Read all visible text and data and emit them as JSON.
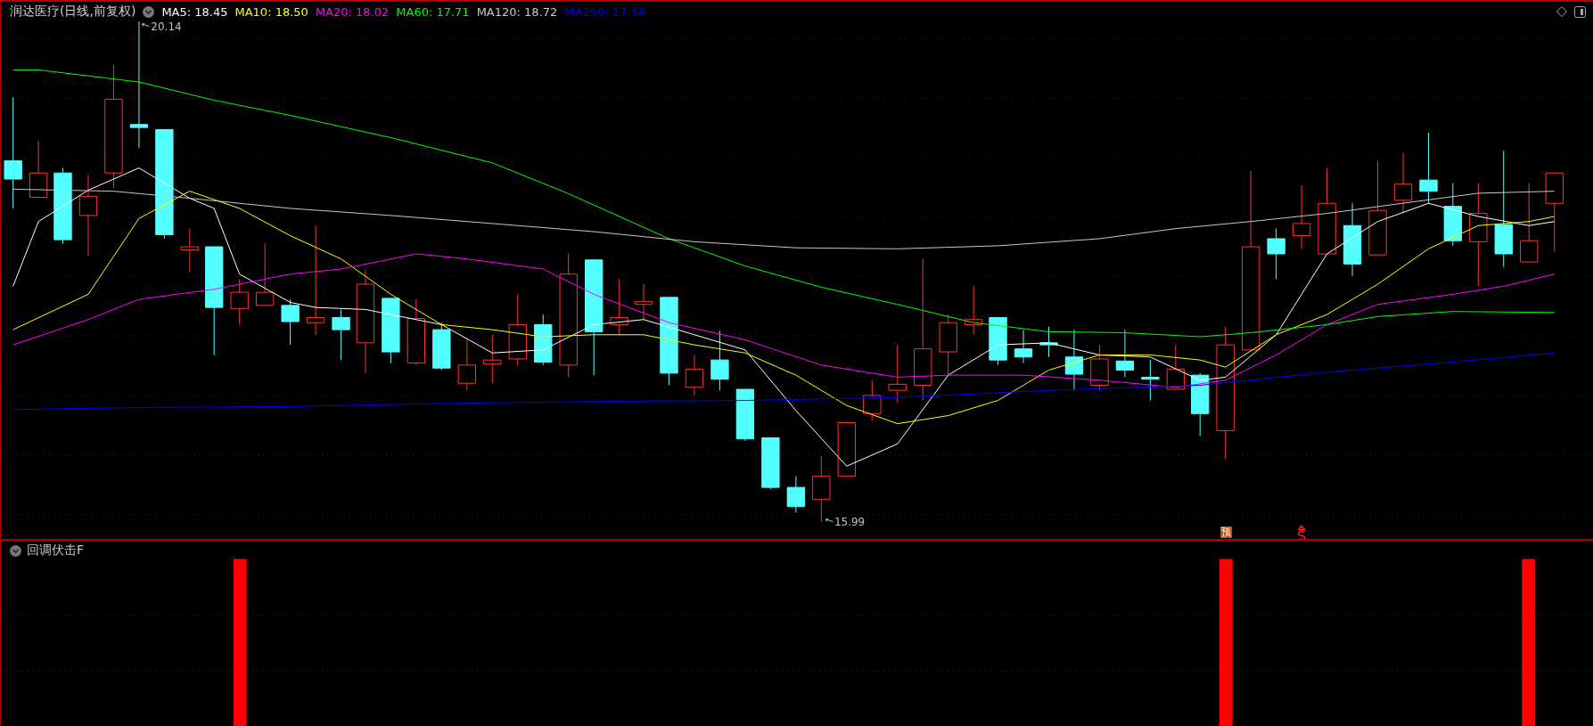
{
  "title": "润达医疗(日线,前复权)",
  "ma_legend": [
    {
      "label": "MA5: 18.45",
      "color": "#ffffff"
    },
    {
      "label": "MA10: 18.50",
      "color": "#ffff00"
    },
    {
      "label": "MA20: 18.02",
      "color": "#ff00ff"
    },
    {
      "label": "MA60: 17.71",
      "color": "#00ff00"
    },
    {
      "label": "MA120: 18.72",
      "color": "#c8c8c8"
    },
    {
      "label": "MA250: 17.38",
      "color": "#0000ff"
    }
  ],
  "price_labels": [
    {
      "text": "20.14"
    },
    {
      "text": "15.99"
    }
  ],
  "markers": [
    {
      "text": "预"
    }
  ],
  "indicator": {
    "title": "回调伏击F"
  }
}
